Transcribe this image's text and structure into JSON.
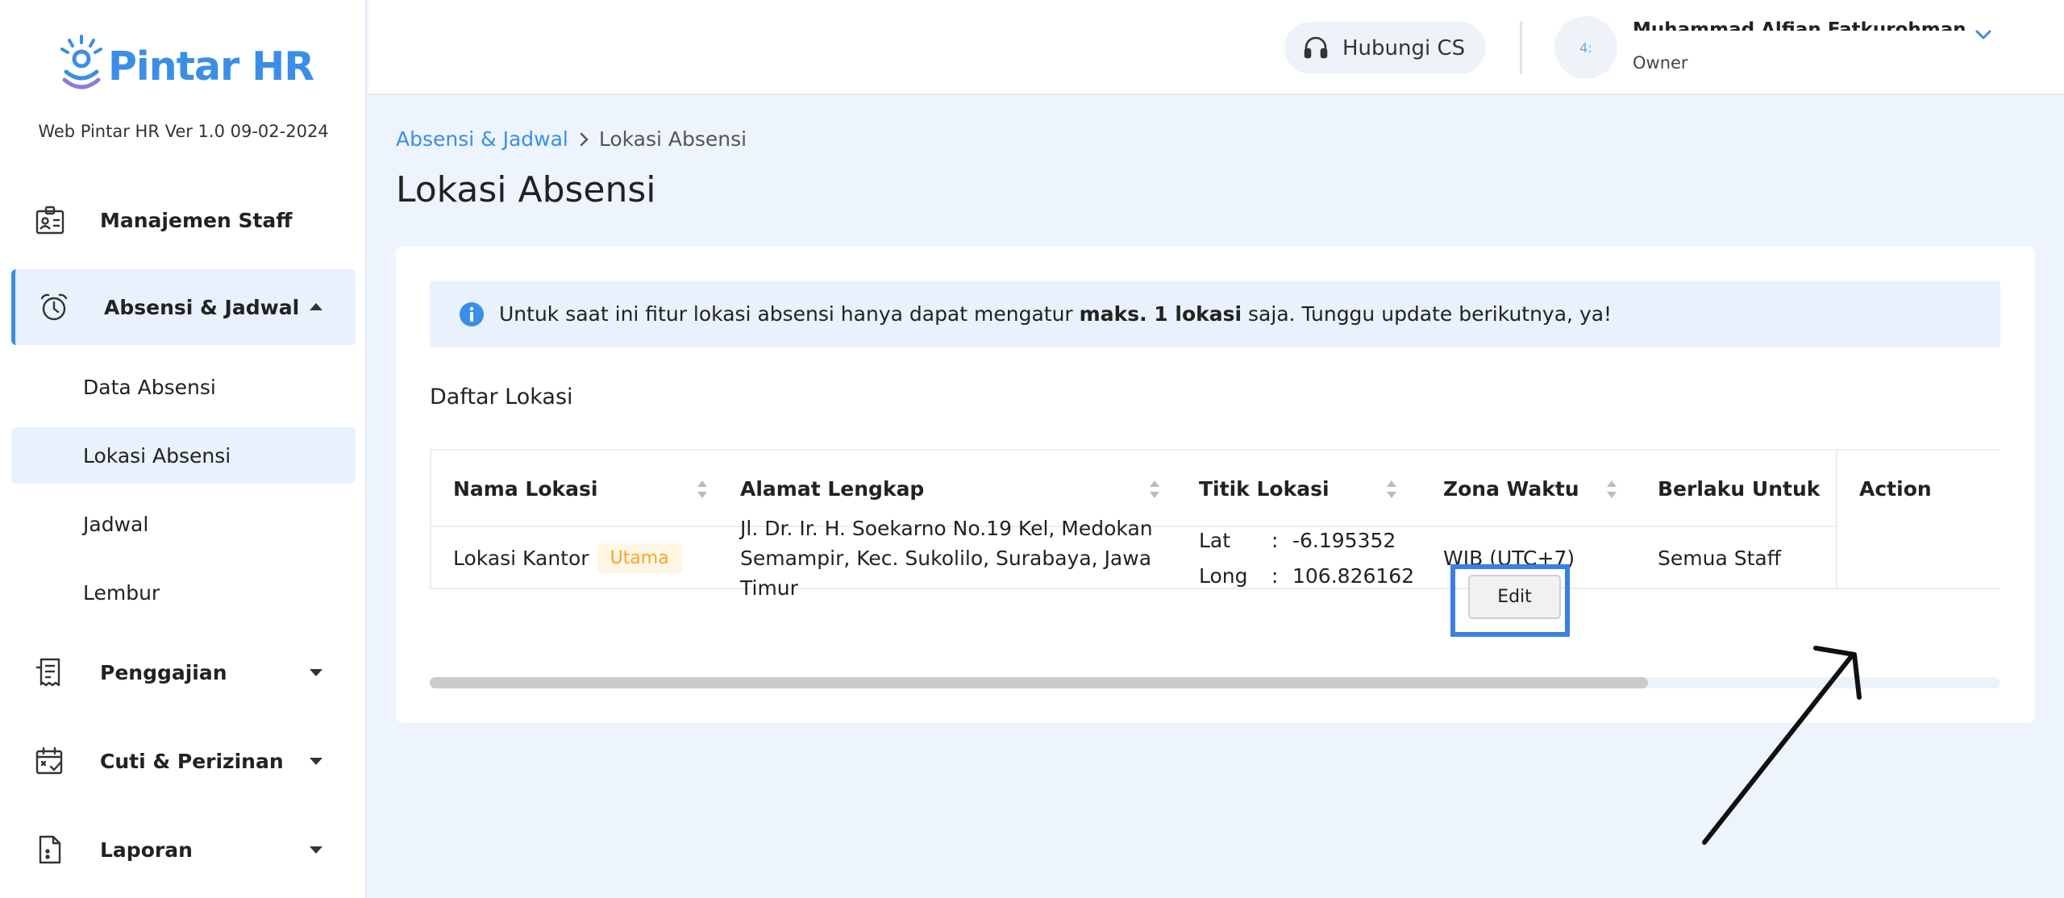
{
  "brand": {
    "logo_text": "Pintar HR",
    "version": "Web Pintar HR Ver 1.0 09-02-2024",
    "accent": "#3b8ee6"
  },
  "sidebar": {
    "items": [
      {
        "label": "Manajemen Staff",
        "icon": "id-card-icon"
      },
      {
        "label": "Absensi & Jadwal",
        "icon": "alarm-clock-icon",
        "expanded": true
      },
      {
        "label": "Penggajian",
        "icon": "receipt-icon"
      },
      {
        "label": "Cuti & Perizinan",
        "icon": "calendar-check-icon"
      },
      {
        "label": "Laporan",
        "icon": "document-icon"
      }
    ],
    "subitems": [
      "Data Absensi",
      "Lokasi Absensi",
      "Jadwal",
      "Lembur"
    ],
    "selected_subitem": "Lokasi Absensi"
  },
  "header": {
    "cs_label": "Hubungi CS",
    "avatar_initials": "4:",
    "user_name": "Muhammad Alfian Fatkurohman Anwar",
    "user_role": "Owner"
  },
  "breadcrumb": {
    "parent": "Absensi & Jadwal",
    "current": "Lokasi Absensi"
  },
  "page_title": "Lokasi Absensi",
  "info": {
    "text_before": "Untuk saat ini fitur lokasi absensi hanya dapat mengatur ",
    "text_bold": "maks. 1 lokasi",
    "text_after": " saja. Tunggu update berikutnya, ya!"
  },
  "list_title": "Daftar Lokasi",
  "table": {
    "columns": [
      "Nama Lokasi",
      "Alamat Lengkap",
      "Titik Lokasi",
      "Zona Waktu",
      "Berlaku Untuk",
      "Action"
    ],
    "rows": [
      {
        "name": "Lokasi Kantor",
        "badge": "Utama",
        "address": "Jl. Dr. Ir. H. Soekarno No.19 Kel, Medokan Semampir, Kec. Sukolilo, Surabaya, Jawa Timur",
        "lat_label": "Lat",
        "lat": "-6.195352",
        "long_label": "Long",
        "long": "106.826162",
        "separator": ":",
        "timezone": "WIB (UTC+7)",
        "applies_to": "Semua Staff",
        "action": "Edit"
      }
    ]
  },
  "scroll": {
    "position_fraction": 0.0,
    "visible_fraction": 0.776
  }
}
